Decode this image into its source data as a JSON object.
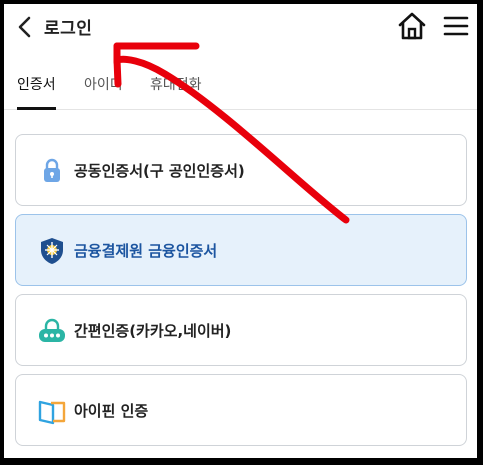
{
  "header": {
    "title": "로그인",
    "back_icon": "chevron-left-icon",
    "home_icon": "home-icon",
    "menu_icon": "hamburger-menu-icon"
  },
  "tabs": [
    {
      "label": "인증서",
      "active": true
    },
    {
      "label": "아이디",
      "active": false
    },
    {
      "label": "휴대전화",
      "active": false
    }
  ],
  "options": [
    {
      "label": "공동인증서(구 공인인증서)",
      "icon": "lock-icon"
    },
    {
      "label": "금융결제원 금융인증서",
      "icon": "shield-emblem-icon",
      "selected": true
    },
    {
      "label": "간편인증(카카오,네이버)",
      "icon": "robot-lock-icon"
    },
    {
      "label": "아이핀 인증",
      "icon": "ipin-card-icon"
    }
  ],
  "colors": {
    "annotation_arrow": "#e8000b",
    "selected_background": "#e6f1fb",
    "selected_text": "#1c55a0"
  }
}
